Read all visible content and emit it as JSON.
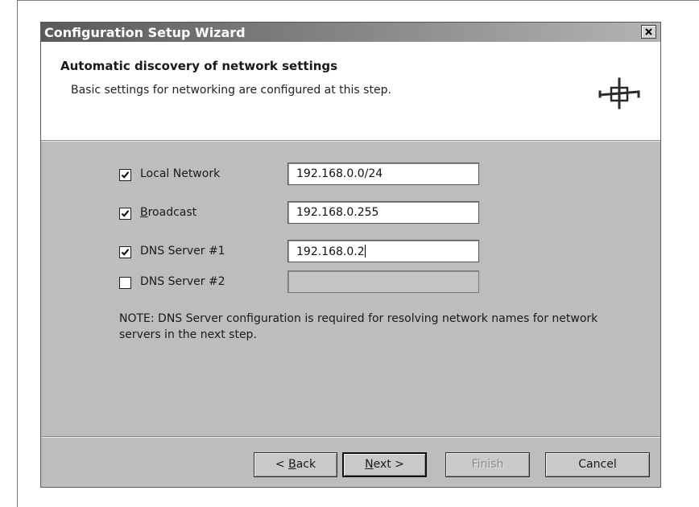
{
  "window": {
    "title": "Configuration Setup Wizard"
  },
  "header": {
    "title": "Automatic discovery of network settings",
    "subtitle": "Basic settings for networking are configured at this step."
  },
  "settings": [
    {
      "label_pre": "Local Network",
      "label_u": "",
      "label_post": "",
      "checked": true,
      "value": "192.168.0.0/24",
      "enabled": true
    },
    {
      "label_pre": "",
      "label_u": "B",
      "label_post": "roadcast",
      "checked": true,
      "value": "192.168.0.255",
      "enabled": true
    },
    {
      "label_pre": "DNS Server #1",
      "label_u": "",
      "label_post": "",
      "checked": true,
      "value": "192.168.0.2",
      "enabled": true,
      "focused": true
    },
    {
      "label_pre": "DNS Server #2",
      "label_u": "",
      "label_post": "",
      "checked": false,
      "value": "",
      "enabled": false
    }
  ],
  "note": "NOTE: DNS Server configuration is required for resolving network names for network servers in the next step.",
  "buttons": {
    "back_pre": "< ",
    "back_u": "B",
    "back_post": "ack",
    "next_u": "N",
    "next_post": "ext >",
    "finish": "Finish",
    "cancel": "Cancel"
  }
}
